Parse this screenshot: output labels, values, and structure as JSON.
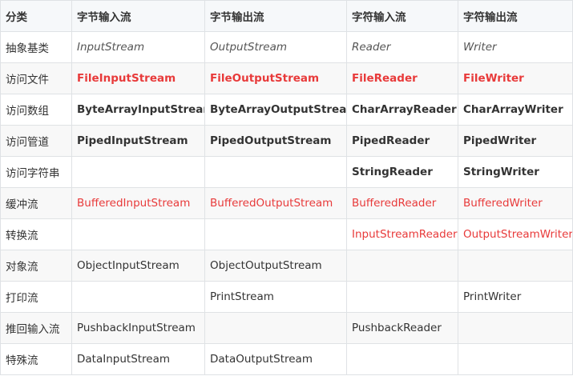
{
  "table": {
    "headers": [
      "分类",
      "字节输入流",
      "字节输出流",
      "字符输入流",
      "字符输出流"
    ],
    "rows": [
      {
        "category": "抽象基类",
        "cells": [
          "InputStream",
          "OutputStream",
          "Reader",
          "Writer"
        ]
      },
      {
        "category": "访问文件",
        "cells": [
          "FileInputStream",
          "FileOutputStream",
          "FileReader",
          "FileWriter"
        ]
      },
      {
        "category": "访问数组",
        "cells": [
          "ByteArrayInputStream",
          "ByteArrayOutputStream",
          "CharArrayReader",
          "CharArrayWriter"
        ]
      },
      {
        "category": "访问管道",
        "cells": [
          "PipedInputStream",
          "PipedOutputStream",
          "PipedReader",
          "PipedWriter"
        ]
      },
      {
        "category": "访问字符串",
        "cells": [
          "",
          "",
          "StringReader",
          "StringWriter"
        ]
      },
      {
        "category": "缓冲流",
        "cells": [
          "BufferedInputStream",
          "BufferedOutputStream",
          "BufferedReader",
          "BufferedWriter"
        ]
      },
      {
        "category": "转换流",
        "cells": [
          "",
          "",
          "InputStreamReader",
          "OutputStreamWriter"
        ]
      },
      {
        "category": "对象流",
        "cells": [
          "ObjectInputStream",
          "ObjectOutputStream",
          "",
          ""
        ]
      },
      {
        "category": "打印流",
        "cells": [
          "",
          "PrintStream",
          "",
          "PrintWriter"
        ]
      },
      {
        "category": "推回输入流",
        "cells": [
          "PushbackInputStream",
          "",
          "PushbackReader",
          ""
        ]
      },
      {
        "category": "特殊流",
        "cells": [
          "DataInputStream",
          "DataOutputStream",
          "",
          ""
        ]
      }
    ]
  },
  "colors": {
    "highlight_red": "#e83a3a",
    "header_bg": "#f6f8fa",
    "border": "#dfe2e5"
  }
}
